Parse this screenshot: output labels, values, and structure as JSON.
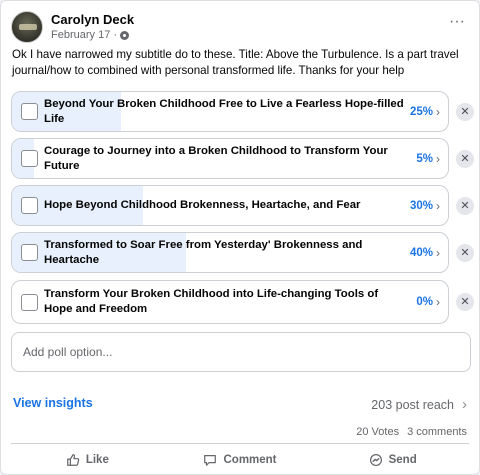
{
  "post": {
    "author": "Carolyn Deck",
    "date": "February 17",
    "date_separator": "·",
    "more_label": "···",
    "text": "Ok I have narrowed my subtitle do to these. Title: Above the Turbulence. Is a part travel journal/how to combined with personal transformed life. Thanks for your help"
  },
  "poll": {
    "options": [
      {
        "label": "Beyond Your Broken Childhood Free to Live a Fearless Hope-filled Life",
        "percent_text": "25%",
        "percent": 25
      },
      {
        "label": "Courage to Journey into a Broken Childhood to Transform Your Future",
        "percent_text": "5%",
        "percent": 5
      },
      {
        "label": "Hope Beyond Childhood Brokenness, Heartache, and Fear",
        "percent_text": "30%",
        "percent": 30
      },
      {
        "label": "Transformed to Soar Free from Yesterday' Brokenness and Heartache",
        "percent_text": "40%",
        "percent": 40
      },
      {
        "label": "Transform Your Broken Childhood into Life-changing Tools of Hope and Freedom",
        "percent_text": "0%",
        "percent": 0
      }
    ],
    "chevron": "›",
    "remove_label": "✕",
    "add_option_placeholder": "Add poll option..."
  },
  "insights": {
    "link_label": "View insights",
    "reach_text": "203 post reach",
    "chevron": "›"
  },
  "stats": {
    "votes": "20 Votes",
    "comments": "3 comments"
  },
  "actions": {
    "like": "Like",
    "comment": "Comment",
    "send": "Send"
  },
  "colors": {
    "accent": "#1b74e4",
    "bar_fill": "#e7f0fc",
    "muted_text": "#65676b"
  },
  "icons": {
    "more": "more-horizontal-icon",
    "privacy": "globe-icon",
    "like": "thumbs-up-icon",
    "comment": "speech-bubble-icon",
    "send": "messenger-icon"
  }
}
